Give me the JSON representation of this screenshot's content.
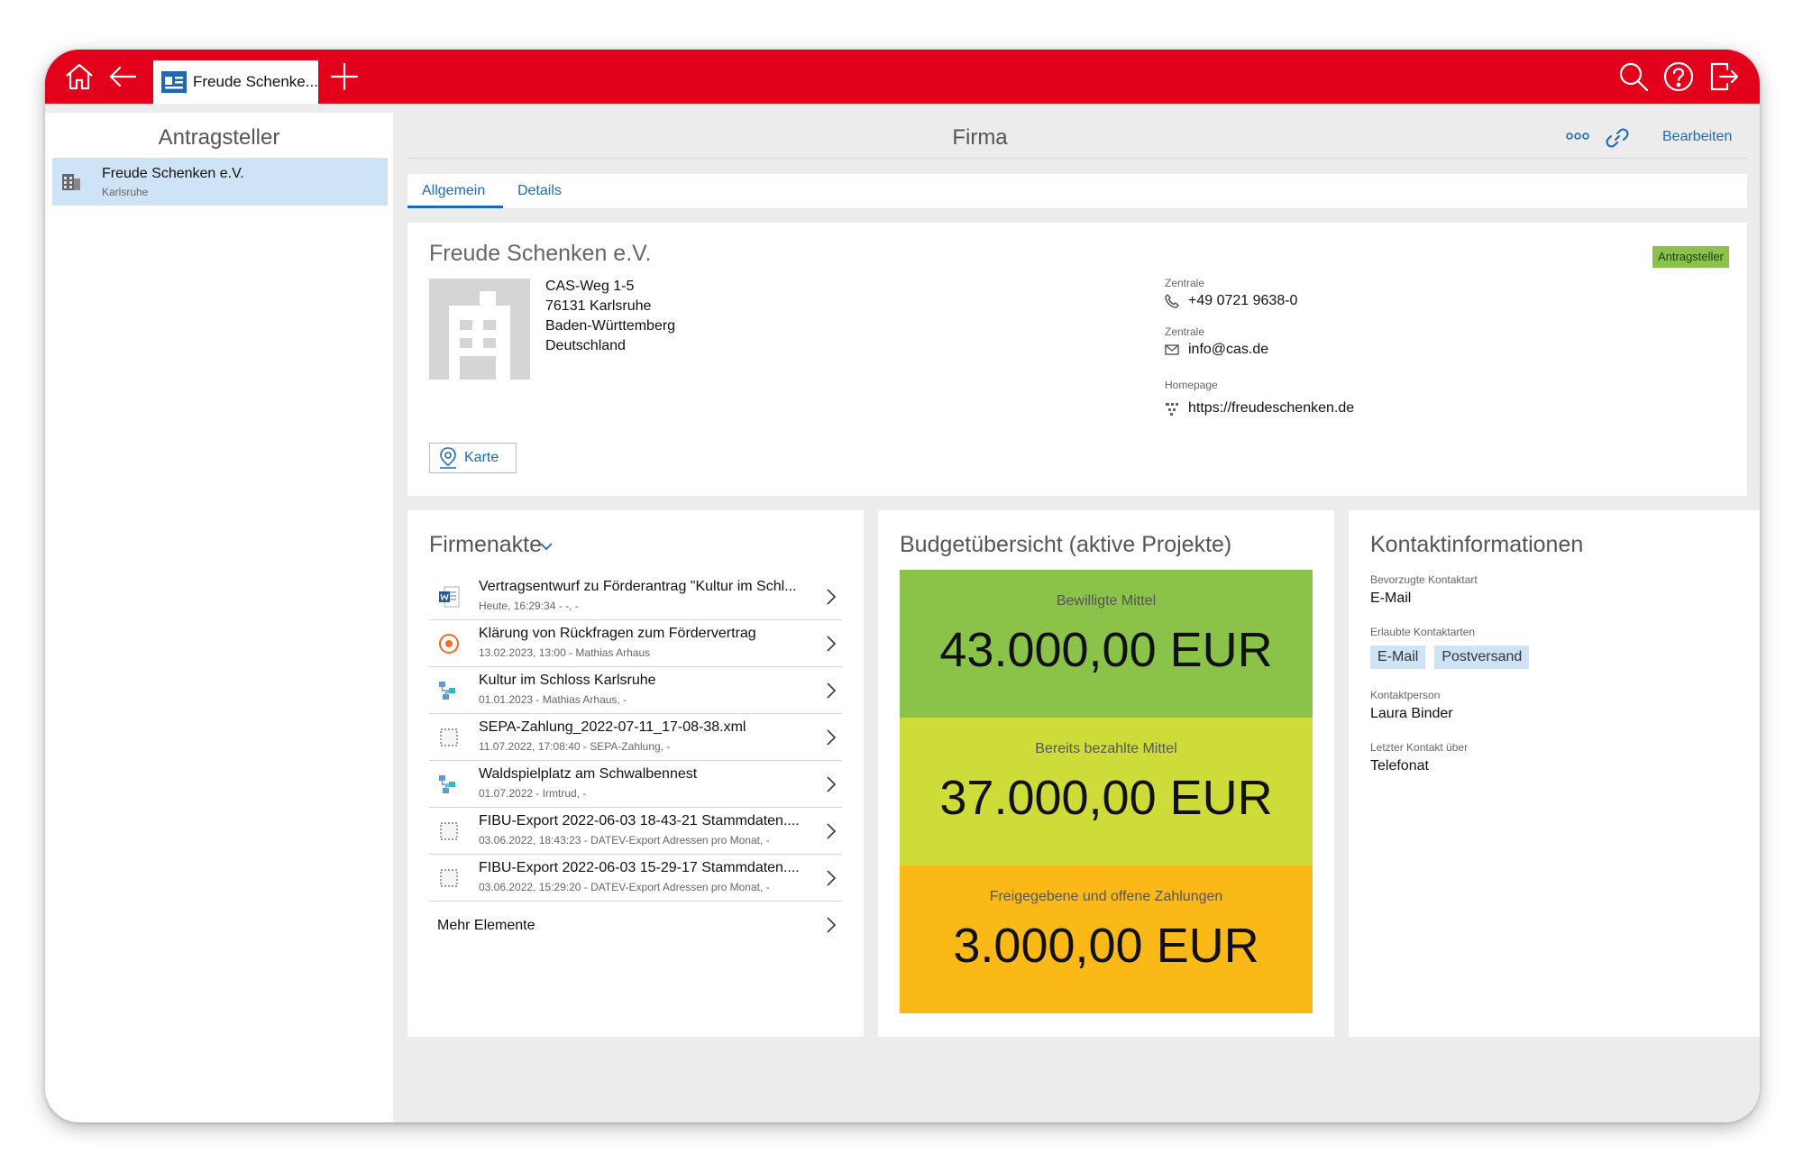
{
  "topbar": {
    "tab_label": "Freude Schenke...",
    "colors": {
      "brand": "#e2001a"
    }
  },
  "left_panel": {
    "title": "Antragsteller",
    "items": [
      {
        "name": "Freude Schenken e.V.",
        "city": "Karlsruhe"
      }
    ]
  },
  "main": {
    "title": "Firma",
    "edit_label": "Bearbeiten",
    "tabs": [
      {
        "label": "Allgemein",
        "active": true
      },
      {
        "label": "Details",
        "active": false
      }
    ]
  },
  "company": {
    "name": "Freude Schenken e.V.",
    "badge": "Antragsteller",
    "address": [
      "CAS-Weg 1-5",
      "76131 Karlsruhe",
      "Baden-Württemberg",
      "Deutschland"
    ],
    "contacts": [
      {
        "label": "Zentrale",
        "value": "+49 0721 9638-0",
        "icon": "phone-icon"
      },
      {
        "label": "Zentrale",
        "value": "info@cas.de",
        "icon": "mail-icon"
      },
      {
        "label": "Homepage",
        "value": "https://freudeschenken.de",
        "icon": "web-icon"
      }
    ],
    "map_button": "Karte"
  },
  "firmenakte": {
    "title": "Firmenakte",
    "items": [
      {
        "title": "Vertragsentwurf zu Förderantrag \"Kultur im Schl...",
        "sub": "Heute, 16:29:34 - -, -",
        "icon": "word-document-icon"
      },
      {
        "title": "Klärung von Rückfragen zum Fördervertrag",
        "sub": "13.02.2023, 13:00 - Mathias Arhaus",
        "icon": "appointment-icon"
      },
      {
        "title": "Kultur im Schloss Karlsruhe",
        "sub": "01.01.2023 - Mathias Arhaus, -",
        "icon": "project-icon"
      },
      {
        "title": "SEPA-Zahlung_2022-07-11_17-08-38.xml",
        "sub": "11.07.2022, 17:08:40 - SEPA-Zahlung, -",
        "icon": "file-icon"
      },
      {
        "title": "Waldspielplatz am Schwalbennest",
        "sub": "01.07.2022 - Irmtrud, -",
        "icon": "project-icon"
      },
      {
        "title": "FIBU-Export 2022-06-03 18-43-21 Stammdaten....",
        "sub": "03.06.2022, 18:43:23 - DATEV-Export Adressen pro Monat, -",
        "icon": "file-icon"
      },
      {
        "title": "FIBU-Export 2022-06-03 15-29-17 Stammdaten....",
        "sub": "03.06.2022, 15:29:20 - DATEV-Export Adressen pro Monat, -",
        "icon": "file-icon"
      }
    ],
    "more_label": "Mehr Elemente"
  },
  "budget": {
    "title": "Budgetübersicht (aktive Projekte)",
    "blocks": [
      {
        "label": "Bewilligte Mittel",
        "value": "43.000,00 EUR",
        "color": "#8bc34a"
      },
      {
        "label": "Bereits bezahlte Mittel",
        "value": "37.000,00 EUR",
        "color": "#cddc39"
      },
      {
        "label": "Freigegebene und offene Zahlungen",
        "value": "3.000,00 EUR",
        "color": "#fbb917"
      }
    ]
  },
  "kontakt": {
    "title": "Kontaktinformationen",
    "preferred_label": "Bevorzugte Kontaktart",
    "preferred_value": "E-Mail",
    "allowed_label": "Erlaubte Kontaktarten",
    "allowed_values": [
      "E-Mail",
      "Postversand"
    ],
    "person_label": "Kontaktperson",
    "person_value": "Laura Binder",
    "last_label": "Letzter Kontakt über",
    "last_value": "Telefonat"
  }
}
